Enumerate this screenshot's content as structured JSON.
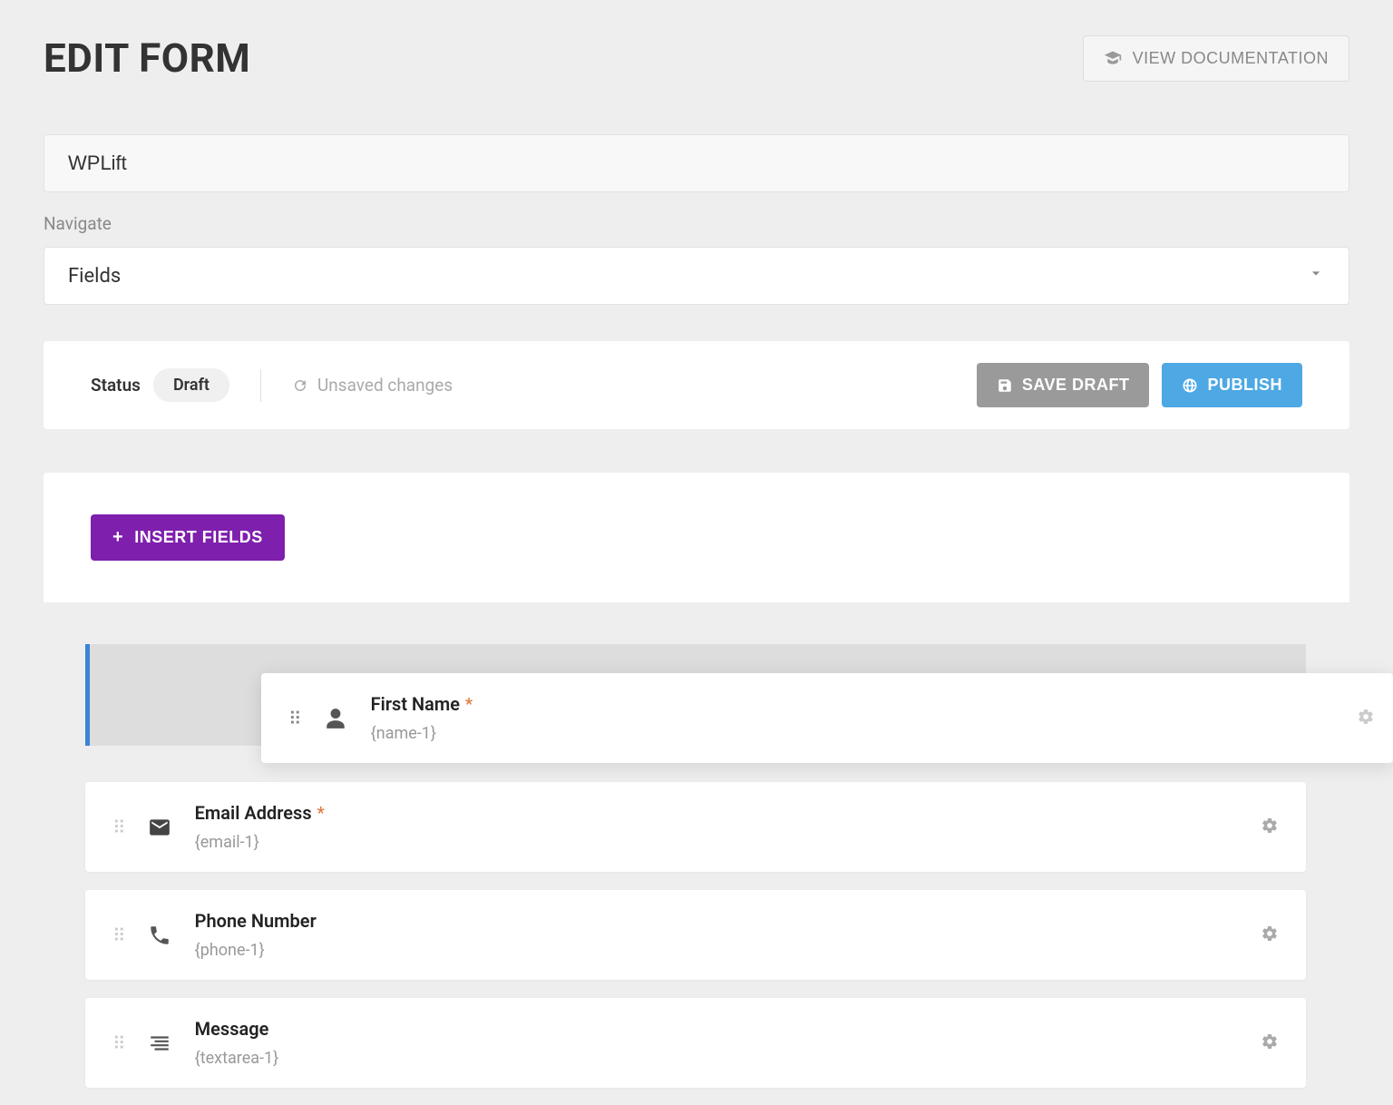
{
  "header": {
    "title": "EDIT FORM",
    "doc_button": "VIEW DOCUMENTATION"
  },
  "form": {
    "name": "WPLift",
    "navigate_label": "Navigate",
    "navigate_value": "Fields"
  },
  "status": {
    "label": "Status",
    "value": "Draft",
    "unsaved": "Unsaved changes",
    "save_draft": "SAVE DRAFT",
    "publish": "PUBLISH"
  },
  "toolbar": {
    "insert_fields": "INSERT FIELDS"
  },
  "fields": [
    {
      "label": "First Name",
      "slug": "{name-1}",
      "required": true,
      "icon": "user",
      "dragging": true
    },
    {
      "label": "Email Address",
      "slug": "{email-1}",
      "required": true,
      "icon": "mail"
    },
    {
      "label": "Phone Number",
      "slug": "{phone-1}",
      "required": false,
      "icon": "phone"
    },
    {
      "label": "Message",
      "slug": "{textarea-1}",
      "required": false,
      "icon": "textarea"
    }
  ]
}
